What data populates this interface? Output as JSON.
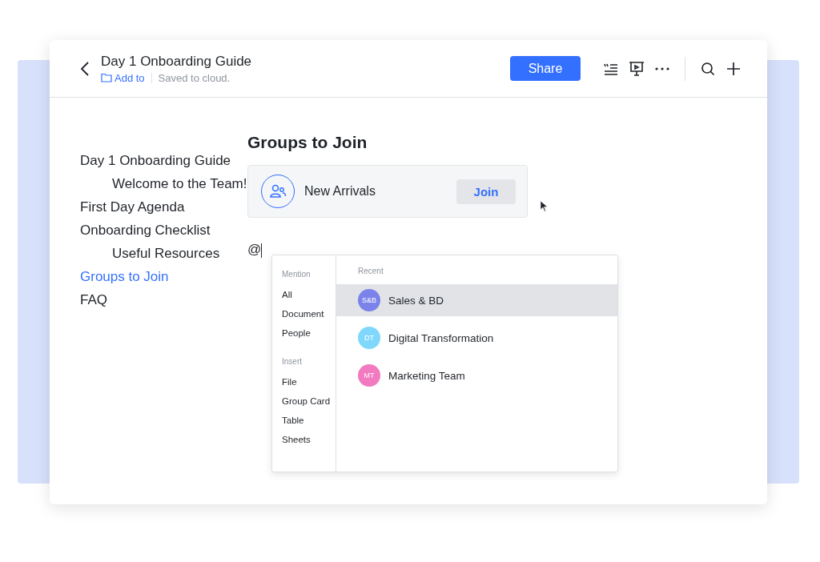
{
  "header": {
    "title": "Day 1 Onboarding Guide",
    "add_to": "Add to",
    "status": "Saved to cloud.",
    "share": "Share"
  },
  "outline": [
    {
      "label": "Day 1 Onboarding Guide",
      "selected": false,
      "children": [
        {
          "label": "Welcome to the Team!",
          "selected": false
        }
      ]
    },
    {
      "label": "First Day Agenda",
      "selected": false
    },
    {
      "label": "Onboarding Checklist",
      "selected": false,
      "children": [
        {
          "label": "Useful Resources",
          "selected": false
        }
      ]
    },
    {
      "label": "Groups to Join",
      "selected": true
    },
    {
      "label": "FAQ",
      "selected": false
    }
  ],
  "heading": "Groups to Join",
  "group_card": {
    "name": "New Arrivals",
    "button": "Join"
  },
  "typed": "@",
  "mention_menu": {
    "sections": [
      {
        "title": "Mention",
        "items": [
          "All",
          "Document",
          "People"
        ]
      },
      {
        "title": "Insert",
        "items": [
          "File",
          "Group Card",
          "Table",
          "Sheets"
        ]
      }
    ],
    "recent_title": "Recent",
    "recent": [
      {
        "initials": "S&B",
        "name": "Sales & BD",
        "color": "#7b83eb",
        "selected": true
      },
      {
        "initials": "DT",
        "name": "Digital Transformation",
        "color": "#7fd8fb",
        "selected": false
      },
      {
        "initials": "MT",
        "name": "Marketing Team",
        "color": "#f27ac0",
        "selected": false
      }
    ]
  }
}
